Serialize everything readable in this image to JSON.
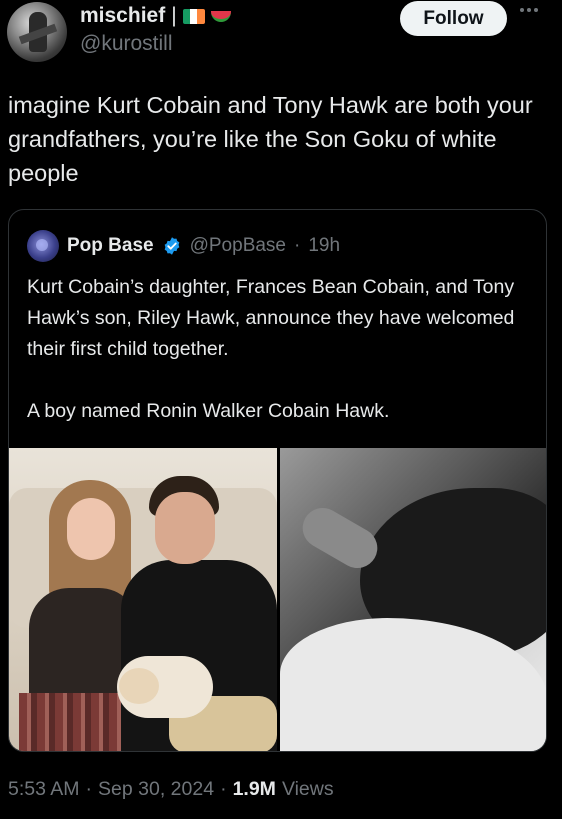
{
  "author": {
    "display_name": "mischief",
    "separator": "|",
    "handle": "@kurostill",
    "flag_colors": [
      "#169b62",
      "#ffffff",
      "#ff883e"
    ]
  },
  "follow_label": "Follow",
  "tweet_text": "imagine Kurt Cobain and Tony Hawk are both your grandfathers, you’re like the Son Goku of white people",
  "quote": {
    "name": "Pop Base",
    "handle": "@PopBase",
    "dot": "·",
    "time": "19h",
    "verified_color": "#1d9bf0",
    "paragraph1": "Kurt Cobain’s daughter, Frances Bean Cobain, and Tony Hawk’s son, Riley Hawk, announce they have welcomed their first child together.",
    "paragraph2": "A boy named Ronin Walker Cobain Hawk."
  },
  "meta": {
    "time": "5:53 AM",
    "sep1": "·",
    "date": "Sep 30, 2024",
    "sep2": "·",
    "views_count": "1.9M",
    "views_label": "Views"
  }
}
